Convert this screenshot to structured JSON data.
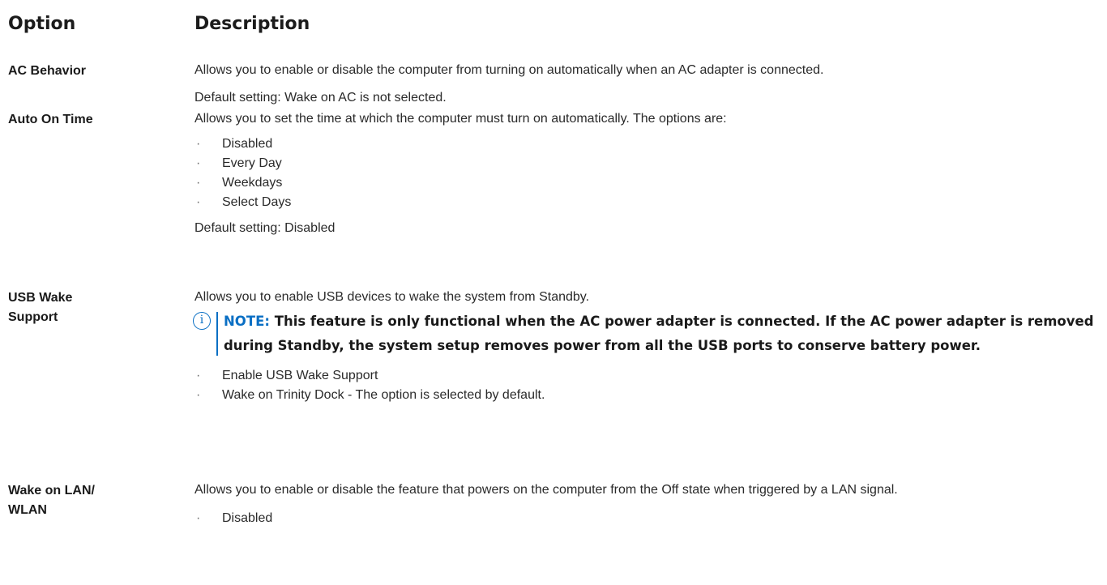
{
  "header": {
    "option": "Option",
    "description": "Description"
  },
  "rows": [
    {
      "option": "AC Behavior",
      "paragraphs": [
        "Allows you to enable or disable the computer from turning on automatically when an AC adapter is connected.",
        "Default setting: Wake on AC is not selected."
      ]
    },
    {
      "option": "Auto On Time",
      "intro": "Allows you to set the time at which the computer must turn on automatically. The options are:",
      "bullets": [
        "Disabled",
        "Every Day",
        "Weekdays",
        "Select Days"
      ],
      "default": "Default setting: Disabled"
    },
    {
      "option_lines": [
        "USB Wake",
        "Support"
      ],
      "intro": "Allows you to enable USB devices to wake the system from Standby.",
      "note_label": "NOTE:",
      "note_text": " This feature is only functional when the AC power adapter is connected. If the AC power adapter is removed during Standby, the system setup removes power from all the USB ports to conserve battery power.",
      "bullets": [
        "Enable USB Wake Support",
        "Wake on Trinity Dock - The option is selected by default."
      ]
    },
    {
      "option_lines": [
        "Wake on LAN/",
        "WLAN"
      ],
      "intro": "Allows you to enable or disable the feature that powers on the computer from the Off state when triggered by a LAN signal.",
      "bullets": [
        "Disabled"
      ]
    }
  ],
  "icons": {
    "note_icon": "info-circle-icon",
    "bullet": "·"
  },
  "colors": {
    "accent": "#0a6fc4",
    "text": "#1a1a1a"
  }
}
